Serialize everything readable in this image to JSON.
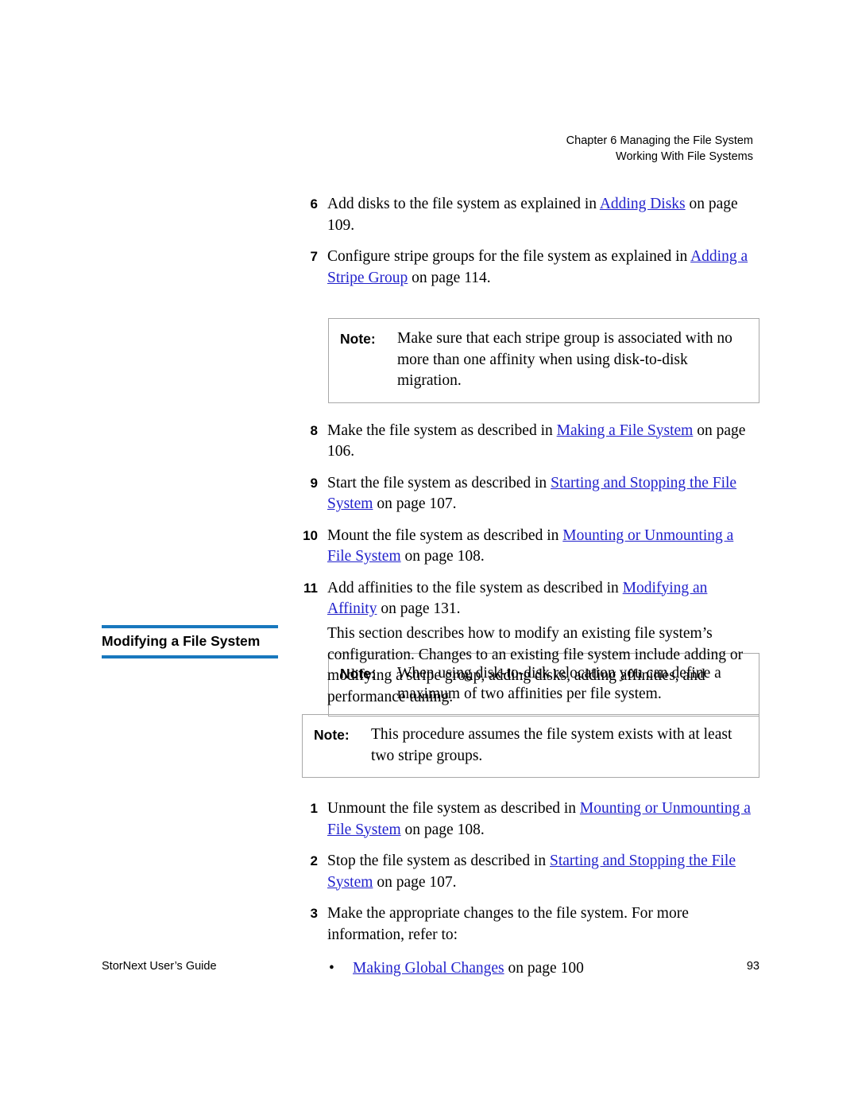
{
  "header": {
    "line1": "Chapter 6  Managing the File System",
    "line2": "Working With File Systems"
  },
  "steps_upper": [
    {
      "num": "6",
      "parts": [
        {
          "t": "Add disks to the file system as explained in ",
          "link": false
        },
        {
          "t": "Adding Disks",
          "link": true
        },
        {
          "t": " on page  109.",
          "link": false
        }
      ]
    },
    {
      "num": "7",
      "parts": [
        {
          "t": "Configure stripe groups for the file system as explained in ",
          "link": false
        },
        {
          "t": "Adding a Stripe Group",
          "link": true
        },
        {
          "t": " on page  114.",
          "link": false
        }
      ]
    }
  ],
  "note1": {
    "label": "Note:",
    "text": "Make sure that each stripe group is associated with no more than one affinity when using disk-to-disk migration."
  },
  "steps_mid": [
    {
      "num": "8",
      "parts": [
        {
          "t": "Make the file system as described in ",
          "link": false
        },
        {
          "t": "Making a File System",
          "link": true
        },
        {
          "t": " on page  106.",
          "link": false
        }
      ]
    },
    {
      "num": "9",
      "parts": [
        {
          "t": "Start the file system as described in ",
          "link": false
        },
        {
          "t": "Starting and Stopping the File System",
          "link": true
        },
        {
          "t": " on page  107.",
          "link": false
        }
      ]
    },
    {
      "num": "10",
      "parts": [
        {
          "t": "Mount the file system as described in ",
          "link": false
        },
        {
          "t": "Mounting or Unmounting a File System",
          "link": true
        },
        {
          "t": " on page  108.",
          "link": false
        }
      ]
    },
    {
      "num": "11",
      "parts": [
        {
          "t": "Add affinities to the file system as described in ",
          "link": false
        },
        {
          "t": "Modifying an Affinity",
          "link": true
        },
        {
          "t": " on page  131.",
          "link": false
        }
      ]
    }
  ],
  "note2": {
    "label": "Note:",
    "text": "When using disk-to-disk relocation you can define a maximum of two affinities per file system."
  },
  "section": {
    "title": "Modifying a File System",
    "rule_color": "#1878be",
    "intro": "This section describes how to modify an existing file system’s configuration. Changes to an existing file system include adding or modifying a stripe group, adding disks, adding affinities, and performance tuning."
  },
  "note3": {
    "label": "Note:",
    "text": "This procedure assumes the file system exists with at least two stripe groups."
  },
  "steps_lower": [
    {
      "num": "1",
      "parts": [
        {
          "t": "Unmount the file system as described in ",
          "link": false
        },
        {
          "t": "Mounting or Unmounting a File System",
          "link": true
        },
        {
          "t": " on page  108.",
          "link": false
        }
      ]
    },
    {
      "num": "2",
      "parts": [
        {
          "t": "Stop the file system as described in ",
          "link": false
        },
        {
          "t": "Starting and Stopping the File System",
          "link": true
        },
        {
          "t": " on page  107.",
          "link": false
        }
      ]
    },
    {
      "num": "3",
      "parts": [
        {
          "t": "Make the appropriate changes to the file system. For more information, refer to:",
          "link": false
        }
      ]
    }
  ],
  "bullets": [
    {
      "marker": "•",
      "parts": [
        {
          "t": "Making Global Changes",
          "link": true
        },
        {
          "t": " on page  100",
          "link": false
        }
      ]
    }
  ],
  "footer": {
    "left": "StorNext User’s Guide",
    "right": "93"
  },
  "colors": {
    "link": "#2222cc",
    "rule": "#1878be",
    "note_border": "#a8a8a8"
  }
}
